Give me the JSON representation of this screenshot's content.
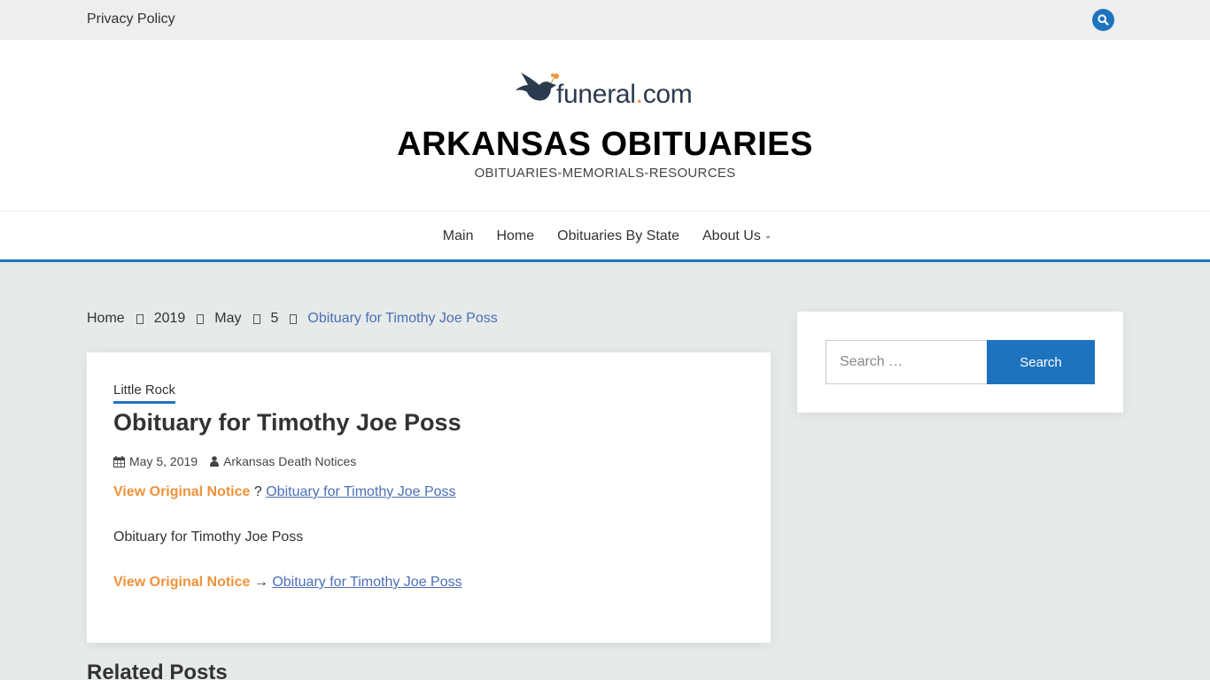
{
  "topbar": {
    "privacy_label": "Privacy Policy",
    "search_icon": "search-icon"
  },
  "header": {
    "logo_text_main": "funeral",
    "logo_text_dot": ".",
    "logo_text_tld": "com",
    "site_title": "ARKANSAS OBITUARIES",
    "tagline": "OBITUARIES-MEMORIALS-RESOURCES"
  },
  "nav": {
    "items": [
      {
        "label": "Main"
      },
      {
        "label": "Home"
      },
      {
        "label": "Obituaries By State"
      },
      {
        "label": "About Us",
        "has_submenu": true
      }
    ]
  },
  "breadcrumb": {
    "items": [
      "Home",
      "2019",
      "May",
      "5"
    ],
    "current": "Obituary for Timothy Joe Poss"
  },
  "post": {
    "category": "Little Rock",
    "title": "Obituary for Timothy Joe Poss",
    "date": "May 5, 2019",
    "author": "Arkansas Death Notices",
    "line1": {
      "label": "View Original Notice",
      "sep": " ? ",
      "link": "Obituary for Timothy Joe Poss"
    },
    "body": "Obituary for Timothy Joe Poss",
    "line2": {
      "label": "View Original Notice",
      "sep": " → ",
      "link": "Obituary for Timothy Joe Poss"
    }
  },
  "related": {
    "heading": "Related Posts"
  },
  "sidebar": {
    "search_placeholder": "Search …",
    "search_button": "Search"
  },
  "colors": {
    "accent": "#1e73be",
    "orange": "#f0923a",
    "link": "#4a6fb5"
  }
}
